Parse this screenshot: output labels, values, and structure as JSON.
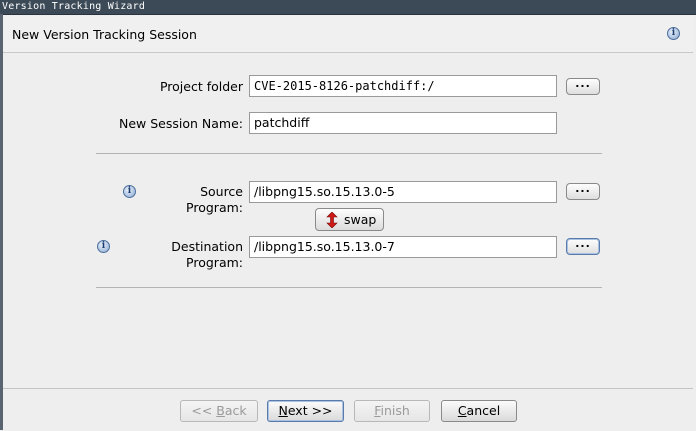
{
  "window": {
    "title": "Version Tracking Wizard"
  },
  "header": {
    "title": "New Version Tracking Session",
    "info_icon": "info-icon"
  },
  "form": {
    "project_folder": {
      "label": "Project folder",
      "value": "CVE-2015-8126-patchdiff:/",
      "browse": "..."
    },
    "session_name": {
      "label": "New Session Name:",
      "value": "patchdiff"
    },
    "source_program": {
      "label": "Source Program:",
      "value": "/libpng15.so.15.13.0-5",
      "browse": "..."
    },
    "swap": {
      "label": "swap",
      "icon": "swap-arrows-icon"
    },
    "destination_program": {
      "label": "Destination Program:",
      "value": "/libpng15.so.15.13.0-7",
      "browse": "..."
    }
  },
  "footer": {
    "back": {
      "prefix": "<< ",
      "mnemonic": "B",
      "rest": "ack"
    },
    "next": {
      "mnemonic": "N",
      "rest": "ext >>"
    },
    "finish": {
      "mnemonic": "F",
      "rest": "inish"
    },
    "cancel": {
      "mnemonic": "C",
      "rest": "ancel"
    }
  },
  "colors": {
    "titlebar": "#3c4a57",
    "background": "#eeeeee",
    "swap_arrow": "#d01818"
  }
}
